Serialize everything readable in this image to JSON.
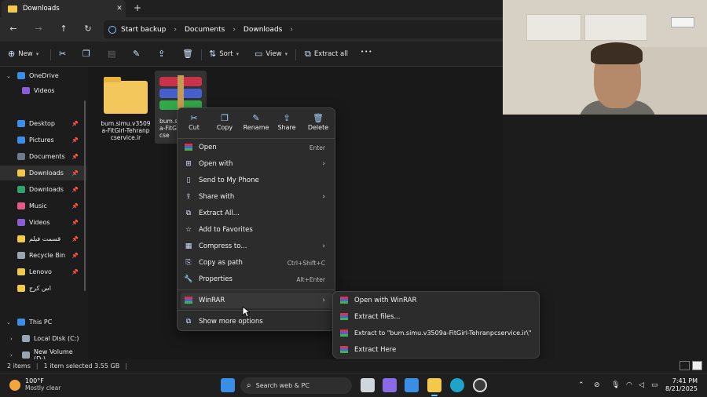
{
  "window": {
    "tab_title": "Downloads",
    "close_glyph": "✕",
    "new_tab_glyph": "+"
  },
  "nav": {
    "back_glyph": "←",
    "forward_glyph": "→",
    "up_glyph": "↑",
    "refresh_glyph": "↻",
    "breadcrumb": [
      "Start backup",
      "Documents",
      "Downloads"
    ],
    "chevron": "›"
  },
  "toolbar": {
    "new_label": "New",
    "sort_label": "Sort",
    "view_label": "View",
    "extract_all_label": "Extract all",
    "more_glyph": "•••"
  },
  "sidebar": {
    "items": [
      {
        "label": "OneDrive",
        "color": "#3a8ee6"
      },
      {
        "label": "Videos",
        "color": "#8a5cd6"
      },
      {
        "label": "Desktop",
        "color": "#3a8ee6"
      },
      {
        "label": "Pictures",
        "color": "#3a8ee6"
      },
      {
        "label": "Documents",
        "color": "#6c7a89"
      },
      {
        "label": "Downloads",
        "color": "#f2c94c"
      },
      {
        "label": "Downloads",
        "color": "#2fa36b"
      },
      {
        "label": "Music",
        "color": "#e55a8a"
      },
      {
        "label": "Videos",
        "color": "#8a5cd6"
      },
      {
        "label": "قسمت فیلم",
        "color": "#f2c94c"
      },
      {
        "label": "Recycle Bin",
        "color": "#9aa5b1"
      },
      {
        "label": "Lenovo",
        "color": "#f2c94c"
      },
      {
        "label": "اس کرج",
        "color": "#f2c94c"
      },
      {
        "label": "This PC",
        "color": "#3a8ee6"
      },
      {
        "label": "Local Disk (C:)",
        "color": "#9aa5b1"
      },
      {
        "label": "New Volume (D:)",
        "color": "#9aa5b1"
      }
    ]
  },
  "files": [
    {
      "name_lines": [
        "bum.simu.v3509",
        "a-FitGirl-Tehranp",
        "cservice.ir"
      ]
    },
    {
      "name_lines": [
        "bum.s",
        "a-FitG",
        "cse"
      ]
    }
  ],
  "context_menu": {
    "quick_actions": [
      {
        "label": "Cut",
        "icon": "scissors-icon",
        "glyph": "✂"
      },
      {
        "label": "Copy",
        "icon": "copy-icon",
        "glyph": "❐"
      },
      {
        "label": "Rename",
        "icon": "rename-icon",
        "glyph": "✎"
      },
      {
        "label": "Share",
        "icon": "share-icon",
        "glyph": "⇪"
      },
      {
        "label": "Delete",
        "icon": "trash-icon",
        "glyph": "🗑"
      }
    ],
    "items": [
      {
        "label": "Open",
        "shortcut": "Enter"
      },
      {
        "label": "Open with",
        "shortcut": ""
      },
      {
        "label": "Send to My Phone",
        "shortcut": ""
      },
      {
        "label": "Share with",
        "shortcut": ""
      },
      {
        "label": "Extract All...",
        "shortcut": ""
      },
      {
        "label": "Add to Favorites",
        "shortcut": ""
      },
      {
        "label": "Compress to...",
        "shortcut": ""
      },
      {
        "label": "Copy as path",
        "shortcut": "Ctrl+Shift+C"
      },
      {
        "label": "Properties",
        "shortcut": "Alt+Enter"
      },
      {
        "label": "WinRAR",
        "shortcut": ""
      },
      {
        "label": "Show more options",
        "shortcut": ""
      }
    ]
  },
  "winrar_submenu": {
    "items": [
      "Open with WinRAR",
      "Extract files...",
      "Extract to \"bum.simu.v3509a-FitGirl-Tehranpcservice.ir\\\"",
      "Extract Here"
    ]
  },
  "status": {
    "items_count": "2 items",
    "selection": "1 item selected  3.55 GB",
    "separator": "|"
  },
  "taskbar": {
    "temperature": "100°F",
    "weather": "Mostly clear",
    "search_placeholder": "Search web & PC",
    "time": "7:41 PM",
    "date": "8/21/2025"
  }
}
